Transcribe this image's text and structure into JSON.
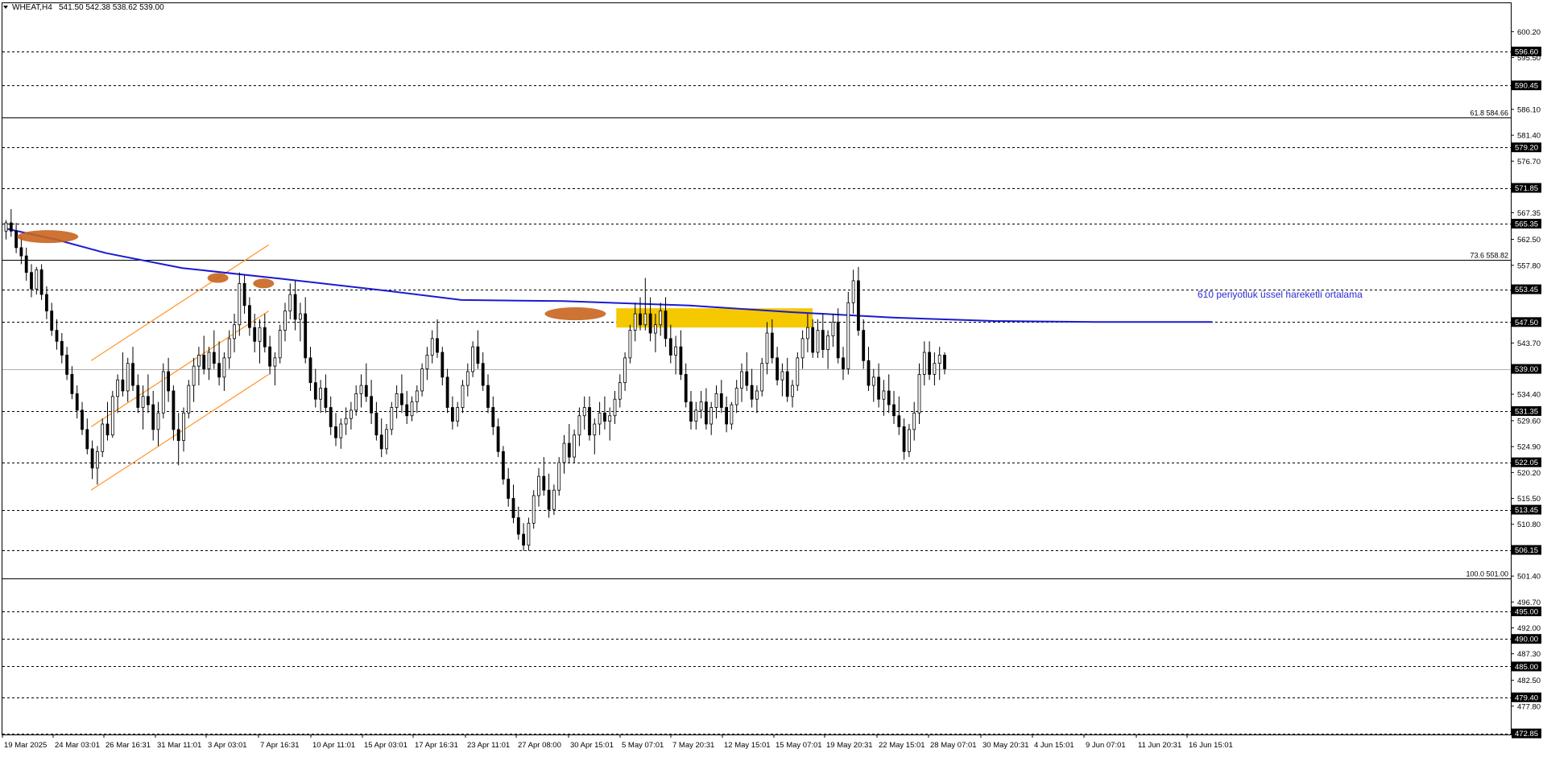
{
  "header": {
    "symbol": "WHEAT,H4",
    "ohlc": "541.50 542.38 538.62 539.00"
  },
  "annotation": {
    "text": "610 periyotluk üssel hareketli ortalama",
    "color": "#2a2ad8"
  },
  "colors": {
    "background": "#ffffff",
    "frame": "#000000",
    "ema": "#1a1ad0",
    "highlight_zone": "#f5c800",
    "channel": "#ff9422",
    "marker": "#c8641e",
    "dashed_level": "#000000",
    "current_price_line": "#b0b0b0"
  },
  "chart_data": {
    "type": "candlestick",
    "instrument": "WHEAT",
    "timeframe": "H4",
    "price_scale": {
      "min": 472.85,
      "max": 602.0,
      "tick_labels": [
        "600.20",
        "595.50",
        "586.10",
        "581.40",
        "576.70",
        "567.35",
        "562.50",
        "557.80",
        "543.70",
        "534.40",
        "529.60",
        "524.90",
        "520.20",
        "515.50",
        "510.80",
        "501.40",
        "496.70",
        "492.00",
        "487.30",
        "482.50",
        "477.80"
      ]
    },
    "time_labels": [
      "19 Mar 2025",
      "24 Mar 03:01",
      "26 Mar 16:31",
      "31 Mar 11:01",
      "3 Apr 03:01",
      "7 Apr 16:31",
      "10 Apr 11:01",
      "15 Apr 03:01",
      "17 Apr 16:31",
      "23 Apr 11:01",
      "27 Apr 08:00",
      "30 Apr 15:01",
      "5 May 07:01",
      "7 May 20:31",
      "12 May 15:01",
      "15 May 07:01",
      "19 May 20:31",
      "22 May 15:01",
      "28 May 07:01",
      "30 May 20:31",
      "4 Jun 15:01",
      "9 Jun 07:01",
      "11 Jun 20:31",
      "16 Jun 15:01"
    ],
    "horizontal_levels": [
      {
        "price": 596.6,
        "label": "596.60"
      },
      {
        "price": 590.45,
        "label": "590.45"
      },
      {
        "price": 579.2,
        "label": "579.20"
      },
      {
        "price": 571.85,
        "label": "571.85"
      },
      {
        "price": 565.35,
        "label": "565.35"
      },
      {
        "price": 553.45,
        "label": "553.45"
      },
      {
        "price": 547.5,
        "label": "547.50"
      },
      {
        "price": 531.35,
        "label": "531.35"
      },
      {
        "price": 522.05,
        "label": "522.05"
      },
      {
        "price": 513.45,
        "label": "513.45"
      },
      {
        "price": 506.15,
        "label": "506.15"
      },
      {
        "price": 495.0,
        "label": "495.00"
      },
      {
        "price": 490.0,
        "label": "490.00"
      },
      {
        "price": 485.0,
        "label": "485.00"
      },
      {
        "price": 479.4,
        "label": "479.40"
      },
      {
        "price": 472.85,
        "label": "472.85"
      }
    ],
    "fibonacci_levels": [
      {
        "price": 584.66,
        "label": "61.8 584.66"
      },
      {
        "price": 558.82,
        "label": "73.6 558.82"
      },
      {
        "price": 501.0,
        "label": "100.0 501.00"
      }
    ],
    "current_price": {
      "price": 539.0,
      "label": "539.00"
    },
    "ema": {
      "period": 610,
      "points": [
        [
          0,
          564.5
        ],
        [
          10,
          562.5
        ],
        [
          20,
          560.0
        ],
        [
          35,
          557.3
        ],
        [
          55,
          555.3
        ],
        [
          75,
          553.2
        ],
        [
          90,
          551.5
        ],
        [
          110,
          551.3
        ],
        [
          135,
          550.5
        ],
        [
          155,
          549.3
        ],
        [
          175,
          548.3
        ],
        [
          195,
          547.7
        ],
        [
          215,
          547.5
        ],
        [
          238,
          547.5
        ]
      ]
    },
    "candles": [
      [
        564.0,
        566.0,
        562.5,
        565.5
      ],
      [
        565.5,
        568.0,
        563.0,
        564.0
      ],
      [
        564.0,
        565.5,
        560.0,
        561.0
      ],
      [
        561.0,
        563.0,
        558.0,
        559.5
      ],
      [
        559.5,
        561.0,
        555.0,
        556.5
      ],
      [
        556.5,
        558.0,
        552.0,
        553.5
      ],
      [
        553.5,
        557.5,
        552.5,
        557.0
      ],
      [
        557.0,
        558.0,
        551.5,
        552.5
      ],
      [
        552.5,
        554.0,
        548.0,
        549.5
      ],
      [
        549.5,
        551.0,
        545.0,
        546.0
      ],
      [
        546.0,
        548.0,
        542.5,
        544.0
      ],
      [
        544.0,
        545.5,
        540.0,
        541.5
      ],
      [
        541.5,
        543.0,
        537.0,
        538.0
      ],
      [
        538.0,
        539.5,
        533.5,
        534.5
      ],
      [
        534.5,
        536.0,
        530.0,
        531.5
      ],
      [
        531.5,
        533.0,
        527.0,
        528.0
      ],
      [
        528.0,
        530.0,
        523.5,
        524.5
      ],
      [
        524.5,
        526.0,
        519.0,
        521.0
      ],
      [
        521.0,
        525.0,
        518.0,
        524.0
      ],
      [
        524.0,
        530.0,
        523.0,
        529.0
      ],
      [
        529.0,
        533.0,
        526.0,
        527.0
      ],
      [
        527.0,
        535.0,
        526.5,
        534.0
      ],
      [
        534.0,
        538.0,
        531.0,
        537.0
      ],
      [
        537.0,
        542.0,
        534.0,
        535.0
      ],
      [
        535.0,
        541.0,
        533.0,
        540.0
      ],
      [
        540.0,
        543.0,
        535.0,
        536.0
      ],
      [
        536.0,
        538.0,
        531.0,
        532.0
      ],
      [
        532.0,
        536.0,
        528.0,
        534.0
      ],
      [
        534.0,
        538.0,
        531.0,
        532.5
      ],
      [
        532.5,
        535.0,
        526.0,
        528.0
      ],
      [
        528.0,
        533.0,
        525.0,
        531.0
      ],
      [
        531.0,
        540.0,
        530.0,
        538.5
      ],
      [
        538.5,
        541.0,
        533.0,
        535.0
      ],
      [
        535.0,
        536.0,
        526.0,
        528.0
      ],
      [
        528.0,
        531.0,
        521.5,
        526.0
      ],
      [
        526.0,
        532.0,
        524.0,
        531.0
      ],
      [
        531.0,
        537.0,
        530.0,
        536.0
      ],
      [
        536.0,
        541.0,
        533.0,
        539.5
      ],
      [
        539.5,
        543.0,
        536.0,
        541.5
      ],
      [
        541.5,
        545.0,
        538.0,
        539.0
      ],
      [
        539.0,
        543.0,
        537.0,
        542.0
      ],
      [
        542.0,
        546.0,
        539.0,
        540.0
      ],
      [
        540.0,
        544.0,
        536.0,
        537.5
      ],
      [
        537.5,
        542.0,
        535.0,
        541.0
      ],
      [
        541.0,
        546.0,
        539.0,
        544.5
      ],
      [
        544.5,
        549.0,
        542.0,
        547.0
      ],
      [
        547.0,
        556.5,
        545.0,
        554.5
      ],
      [
        554.5,
        556.0,
        549.0,
        550.5
      ],
      [
        550.5,
        552.0,
        545.0,
        546.5
      ],
      [
        546.5,
        549.0,
        542.0,
        544.0
      ],
      [
        544.0,
        548.0,
        540.0,
        546.5
      ],
      [
        546.5,
        549.0,
        542.0,
        543.0
      ],
      [
        543.0,
        545.0,
        538.0,
        539.5
      ],
      [
        539.5,
        542.0,
        536.0,
        541.0
      ],
      [
        541.0,
        547.0,
        540.0,
        546.0
      ],
      [
        546.0,
        551.0,
        544.0,
        549.5
      ],
      [
        549.5,
        554.5,
        548.0,
        552.5
      ],
      [
        552.5,
        555.0,
        546.0,
        548.0
      ],
      [
        548.0,
        551.0,
        544.0,
        549.0
      ],
      [
        549.0,
        552.0,
        540.0,
        541.0
      ],
      [
        541.0,
        543.0,
        535.0,
        536.5
      ],
      [
        536.5,
        539.0,
        532.0,
        533.5
      ],
      [
        533.5,
        537.0,
        531.0,
        535.5
      ],
      [
        535.5,
        538.0,
        531.0,
        532.0
      ],
      [
        532.0,
        534.0,
        527.0,
        528.5
      ],
      [
        528.5,
        531.0,
        525.0,
        526.5
      ],
      [
        526.5,
        530.0,
        524.5,
        529.0
      ],
      [
        529.0,
        532.0,
        527.0,
        530.0
      ],
      [
        530.0,
        533.0,
        528.0,
        531.5
      ],
      [
        531.5,
        536.0,
        530.5,
        534.5
      ],
      [
        534.5,
        538.0,
        532.0,
        536.0
      ],
      [
        536.0,
        540.0,
        533.0,
        534.0
      ],
      [
        534.0,
        537.0,
        529.0,
        531.0
      ],
      [
        531.0,
        533.0,
        526.0,
        527.0
      ],
      [
        527.0,
        530.0,
        523.0,
        524.5
      ],
      [
        524.5,
        529.0,
        523.5,
        528.0
      ],
      [
        528.0,
        533.0,
        527.0,
        532.0
      ],
      [
        532.0,
        536.0,
        530.0,
        534.5
      ],
      [
        534.5,
        538.0,
        531.0,
        532.5
      ],
      [
        532.5,
        535.0,
        529.0,
        530.5
      ],
      [
        530.5,
        534.0,
        529.5,
        533.0
      ],
      [
        533.0,
        536.0,
        531.0,
        535.0
      ],
      [
        535.0,
        540.0,
        534.0,
        539.0
      ],
      [
        539.0,
        543.0,
        537.0,
        541.5
      ],
      [
        541.5,
        546.0,
        540.0,
        544.5
      ],
      [
        544.5,
        548.0,
        541.0,
        542.0
      ],
      [
        542.0,
        543.0,
        536.0,
        537.5
      ],
      [
        537.5,
        539.0,
        531.0,
        532.0
      ],
      [
        532.0,
        534.0,
        528.0,
        529.5
      ],
      [
        529.5,
        533.0,
        528.5,
        532.0
      ],
      [
        532.0,
        537.0,
        531.0,
        536.0
      ],
      [
        536.0,
        540.0,
        534.0,
        538.5
      ],
      [
        538.5,
        544.0,
        537.5,
        543.0
      ],
      [
        543.0,
        546.0,
        539.0,
        540.0
      ],
      [
        540.0,
        542.0,
        535.0,
        536.0
      ],
      [
        536.0,
        538.0,
        531.0,
        532.0
      ],
      [
        532.0,
        534.0,
        527.0,
        528.5
      ],
      [
        528.5,
        530.0,
        523.0,
        524.0
      ],
      [
        524.0,
        525.0,
        518.0,
        519.0
      ],
      [
        519.0,
        521.0,
        514.0,
        515.5
      ],
      [
        515.5,
        518.0,
        511.0,
        512.0
      ],
      [
        512.0,
        514.0,
        508.0,
        509.0
      ],
      [
        509.0,
        511.0,
        506.0,
        507.0
      ],
      [
        507.0,
        512.0,
        506.0,
        511.0
      ],
      [
        511.0,
        517.0,
        510.0,
        516.0
      ],
      [
        516.0,
        521.0,
        514.0,
        519.5
      ],
      [
        519.5,
        523.0,
        516.0,
        517.0
      ],
      [
        517.0,
        520.0,
        512.0,
        513.5
      ],
      [
        513.5,
        518.0,
        512.5,
        517.0
      ],
      [
        517.0,
        523.0,
        516.0,
        522.0
      ],
      [
        522.0,
        527.0,
        520.0,
        525.5
      ],
      [
        525.5,
        529.0,
        522.0,
        523.0
      ],
      [
        523.0,
        528.0,
        522.0,
        527.0
      ],
      [
        527.0,
        532.0,
        525.0,
        530.5
      ],
      [
        530.5,
        534.0,
        528.0,
        532.0
      ],
      [
        532.0,
        534.0,
        526.0,
        527.0
      ],
      [
        527.0,
        530.0,
        523.5,
        529.0
      ],
      [
        529.0,
        533.0,
        527.0,
        531.0
      ],
      [
        531.0,
        534.0,
        528.0,
        529.5
      ],
      [
        529.5,
        532.0,
        526.0,
        530.5
      ],
      [
        530.5,
        535.0,
        529.0,
        533.5
      ],
      [
        533.5,
        538.0,
        532.0,
        536.5
      ],
      [
        536.5,
        542.0,
        535.0,
        541.0
      ],
      [
        541.0,
        547.0,
        540.0,
        546.0
      ],
      [
        546.0,
        551.0,
        544.0,
        549.0
      ],
      [
        549.0,
        552.0,
        546.0,
        547.0
      ],
      [
        547.0,
        555.5,
        546.0,
        549.0
      ],
      [
        549.0,
        552.0,
        544.0,
        545.5
      ],
      [
        545.5,
        549.0,
        542.0,
        547.0
      ],
      [
        547.0,
        551.0,
        545.0,
        549.5
      ],
      [
        549.5,
        552.0,
        543.0,
        544.5
      ],
      [
        544.5,
        547.0,
        540.0,
        541.5
      ],
      [
        541.5,
        545.0,
        538.0,
        543.0
      ],
      [
        543.0,
        546.0,
        537.0,
        538.0
      ],
      [
        538.0,
        540.0,
        532.0,
        533.0
      ],
      [
        533.0,
        535.0,
        528.0,
        529.5
      ],
      [
        529.5,
        533.0,
        528.0,
        531.5
      ],
      [
        531.5,
        535.0,
        530.0,
        533.0
      ],
      [
        533.0,
        535.5,
        528.0,
        529.0
      ],
      [
        529.0,
        533.0,
        527.0,
        532.0
      ],
      [
        532.0,
        536.0,
        530.0,
        534.5
      ],
      [
        534.5,
        537.0,
        531.0,
        532.0
      ],
      [
        532.0,
        534.0,
        527.5,
        529.0
      ],
      [
        529.0,
        533.0,
        528.0,
        532.5
      ],
      [
        532.5,
        537.0,
        531.0,
        535.5
      ],
      [
        535.5,
        540.0,
        533.0,
        538.5
      ],
      [
        538.5,
        542.0,
        535.0,
        536.0
      ],
      [
        536.0,
        539.0,
        532.0,
        533.5
      ],
      [
        533.5,
        536.0,
        531.0,
        535.0
      ],
      [
        535.0,
        541.0,
        534.0,
        540.0
      ],
      [
        540.0,
        547.5,
        538.0,
        545.5
      ],
      [
        545.5,
        548.0,
        540.0,
        541.0
      ],
      [
        541.0,
        543.0,
        536.0,
        537.0
      ],
      [
        537.0,
        540.0,
        534.0,
        538.5
      ],
      [
        538.5,
        541.0,
        533.0,
        534.0
      ],
      [
        534.0,
        537.0,
        532.0,
        536.0
      ],
      [
        536.0,
        542.0,
        535.0,
        541.0
      ],
      [
        541.0,
        546.0,
        539.0,
        544.5
      ],
      [
        544.5,
        549.0,
        542.0,
        546.5
      ],
      [
        546.5,
        548.0,
        541.0,
        542.0
      ],
      [
        542.0,
        548.0,
        541.0,
        546.0
      ],
      [
        546.0,
        549.0,
        541.0,
        542.5
      ],
      [
        542.5,
        546.0,
        539.0,
        545.0
      ],
      [
        545.0,
        549.0,
        543.0,
        547.5
      ],
      [
        547.5,
        550.0,
        540.0,
        541.0
      ],
      [
        541.0,
        543.0,
        537.0,
        539.0
      ],
      [
        539.0,
        553.0,
        538.0,
        551.0
      ],
      [
        551.0,
        557.0,
        549.0,
        555.0
      ],
      [
        555.0,
        557.5,
        545.0,
        546.0
      ],
      [
        546.0,
        548.0,
        539.0,
        540.5
      ],
      [
        540.5,
        543.0,
        535.0,
        536.0
      ],
      [
        536.0,
        539.0,
        533.0,
        537.5
      ],
      [
        537.5,
        540.0,
        532.0,
        533.5
      ],
      [
        533.5,
        537.0,
        530.5,
        535.0
      ],
      [
        535.0,
        538.0,
        531.0,
        532.5
      ],
      [
        532.5,
        535.0,
        529.0,
        530.5
      ],
      [
        530.5,
        534.0,
        527.0,
        528.5
      ],
      [
        528.5,
        530.0,
        522.5,
        524.0
      ],
      [
        524.0,
        529.0,
        523.0,
        528.0
      ],
      [
        528.0,
        533.0,
        526.0,
        531.0
      ],
      [
        531.0,
        540.0,
        529.0,
        538.0
      ],
      [
        538.0,
        544.0,
        536.0,
        542.0
      ],
      [
        542.0,
        544.0,
        537.0,
        538.0
      ],
      [
        538.0,
        542.0,
        536.0,
        540.0
      ],
      [
        540.0,
        543.0,
        537.0,
        541.5
      ],
      [
        541.5,
        542.0,
        538.0,
        539.0
      ]
    ],
    "channel_lines": [
      {
        "from": [
          17,
          517.0
        ],
        "to": [
          52,
          538.0
        ]
      },
      {
        "from": [
          17,
          528.5
        ],
        "to": [
          52,
          549.5
        ]
      },
      {
        "from": [
          17,
          540.5
        ],
        "to": [
          52,
          561.5
        ]
      }
    ],
    "markers": [
      {
        "index": 4,
        "price": 563.0
      },
      {
        "index": 42,
        "price": 555.5
      },
      {
        "index": 51,
        "price": 554.5
      },
      {
        "index": 108,
        "price": 549.0
      }
    ],
    "highlight_zone": {
      "from_index": 121,
      "to_index": 157,
      "price_low": 546.5,
      "price_high": 550.0
    }
  }
}
